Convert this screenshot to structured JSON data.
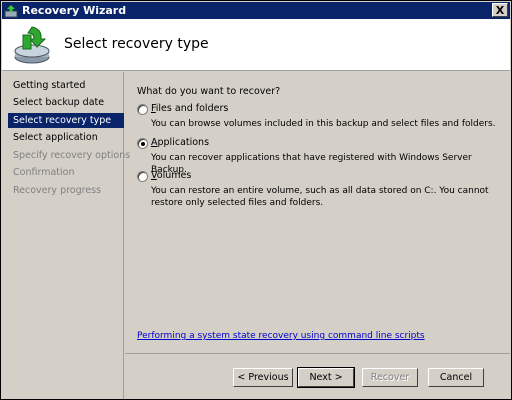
{
  "window": {
    "title": "Recovery Wizard",
    "close_glyph": "X"
  },
  "header": {
    "title": "Select recovery type"
  },
  "steps": [
    {
      "label": "Getting started",
      "state": "normal"
    },
    {
      "label": "Select backup date",
      "state": "normal"
    },
    {
      "label": "Select recovery type",
      "state": "active"
    },
    {
      "label": "Select application",
      "state": "normal"
    },
    {
      "label": "Specify recovery options",
      "state": "disabled"
    },
    {
      "label": "Confirmation",
      "state": "disabled"
    },
    {
      "label": "Recovery progress",
      "state": "disabled"
    }
  ],
  "content": {
    "question": "What do you want to recover?",
    "options": [
      {
        "label": "Files and folders",
        "mnemonic": "F",
        "rest": "iles and folders",
        "selected": false,
        "description": "You can browse volumes included in this backup and select files and folders."
      },
      {
        "label": "Applications",
        "mnemonic": "A",
        "rest": "pplications",
        "selected": true,
        "description": "You can recover applications that have registered with Windows Server Backup."
      },
      {
        "label": "Volumes",
        "mnemonic": "V",
        "rest": "olumes",
        "selected": false,
        "description": "You can restore an entire volume, such as all data stored on C:. You cannot restore only selected files and folders."
      }
    ],
    "link": "Performing a system state recovery using command line scripts"
  },
  "buttons": {
    "previous": "< Previous",
    "next": "Next >",
    "recover": "Recover",
    "cancel": "Cancel"
  },
  "colors": {
    "selection": "#0a246a",
    "link": "#0000cc",
    "face": "#d4d0c8"
  },
  "icons": {
    "app": "recovery-icon",
    "wizard": "recovery-arrow-disk-icon"
  }
}
